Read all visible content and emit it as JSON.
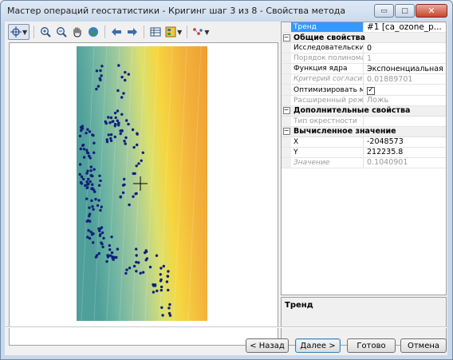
{
  "window": {
    "title": "Мастер операций геостатистики - Кригинг шаг 3 из 8 - Свойства метода",
    "controls": {
      "minimize": "▭",
      "maximize": "□",
      "close": "✕"
    }
  },
  "toolbar": {
    "icons": [
      "pan-select",
      "zoom-in",
      "zoom-out",
      "pan-hand",
      "full-extent",
      "back",
      "forward",
      "table",
      "legend",
      "add-points"
    ]
  },
  "map": {
    "colors": {
      "surface": [
        "#4f9f9a",
        "#6bb3a3",
        "#a6cc9b",
        "#dbe06e",
        "#f6d63f",
        "#f3b43c",
        "#ef9b31"
      ],
      "points": "#0f1f7a"
    }
  },
  "properties": {
    "top": {
      "name": "Тренд",
      "value": "#1 [ca_ozone_p..."
    },
    "categories": [
      {
        "label": "Общие свойства",
        "toggle": "−",
        "rows": [
          {
            "name": "Исследовательски...",
            "value": "0",
            "disabled": false,
            "italic": false
          },
          {
            "name": "Порядок полинома",
            "value": "1",
            "disabled": true,
            "italic": false
          },
          {
            "name": "Функция ядра",
            "value": "Экспоненциальная",
            "disabled": false,
            "italic": false
          },
          {
            "name": "Критерий согласия",
            "value": "0.01889701",
            "disabled": true,
            "italic": true
          },
          {
            "name": "Оптимизировать м...",
            "value": "",
            "check": "✓",
            "disabled": false,
            "italic": false
          },
          {
            "name": "Расширенный режим",
            "value": "Ложь",
            "disabled": true,
            "italic": false
          }
        ]
      },
      {
        "label": "Дополнительные свойства",
        "toggle": "−",
        "rows": [
          {
            "name": "Тип окрестности",
            "value": "",
            "disabled": true,
            "italic": false
          }
        ]
      },
      {
        "label": "Вычисленное значение",
        "toggle": "−",
        "rows": [
          {
            "name": "X",
            "value": "-2048573",
            "disabled": false,
            "italic": false
          },
          {
            "name": "Y",
            "value": "212235.8",
            "disabled": false,
            "italic": false
          },
          {
            "name": "Значение",
            "value": "0.1040901",
            "disabled": true,
            "italic": true
          }
        ]
      }
    ],
    "description_title": "Тренд"
  },
  "buttons": {
    "back": "< Назад",
    "next": "Далее >",
    "finish": "Готово",
    "cancel": "Отмена"
  },
  "accent": "#3399ff"
}
